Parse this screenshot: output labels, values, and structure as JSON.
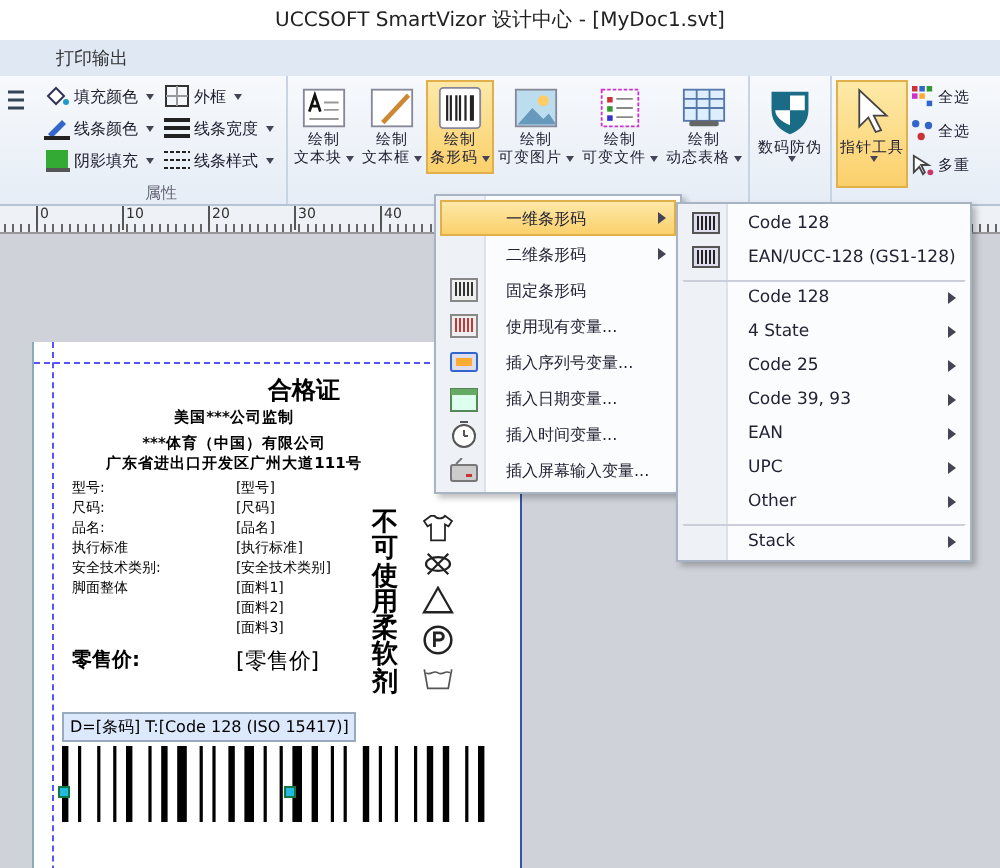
{
  "window": {
    "title": "UCCSOFT SmartVizor 设计中心 - [MyDoc1.svt]"
  },
  "tabs": [
    {
      "label": "打印输出",
      "selected": false
    }
  ],
  "ribbon": {
    "format_group": {
      "label": "属性",
      "tools": [
        {
          "label": "填充颜色"
        },
        {
          "label": "外框"
        },
        {
          "label": "线条颜色"
        },
        {
          "label": "线条宽度"
        },
        {
          "label": "阴影填充"
        },
        {
          "label": "线条样式"
        }
      ]
    },
    "draw_buttons": [
      {
        "line1": "绘制",
        "line2": "文本块",
        "selected": false
      },
      {
        "line1": "绘制",
        "line2": "文本框",
        "selected": false
      },
      {
        "line1": "绘制",
        "line2": "条形码",
        "selected": true
      },
      {
        "line1": "绘制",
        "line2": "可变图片",
        "selected": false
      },
      {
        "line1": "绘制",
        "line2": "可变文件",
        "selected": false
      },
      {
        "line1": "绘制",
        "line2": "动态表格",
        "selected": false
      }
    ],
    "security_button": {
      "label": "数码防伪"
    },
    "pointer_button": {
      "label": "指针工具",
      "selected": true
    },
    "select_tools": [
      {
        "label": "全选"
      },
      {
        "label": "全选"
      },
      {
        "label": "多重"
      }
    ]
  },
  "ruler": {
    "ticks": [
      "0",
      "10",
      "20",
      "30",
      "40"
    ]
  },
  "label": {
    "title": "合格证",
    "lines": [
      "美国***公司监制",
      "***体育（中国）有限公司",
      "广东省进出口开发区广州大道111号"
    ],
    "fields": [
      {
        "name": "型号:",
        "value": "[型号]"
      },
      {
        "name": "尺码:",
        "value": "[尺码]"
      },
      {
        "name": "品名:",
        "value": "[品名]"
      },
      {
        "name": "执行标准",
        "value": "[执行标准]"
      },
      {
        "name": "安全技术类别:",
        "value": "[安全技术类别]"
      },
      {
        "name": "脚面整体",
        "value": "[面料1]"
      },
      {
        "value": "[面料2]"
      },
      {
        "value": "[面料3]"
      }
    ],
    "price": {
      "name": "零售价:",
      "value": "[零售价]"
    },
    "vertical_text": "不可使用柔软剂",
    "barcode_caption": "D=[条码] T:[Code 128 (ISO 15417)]"
  },
  "menu": {
    "items": [
      {
        "label": "一维条形码",
        "submenu": true,
        "selected": true
      },
      {
        "label": "二维条形码",
        "submenu": true,
        "selected": false
      },
      {
        "label": "固定条形码",
        "submenu": false,
        "selected": false
      },
      {
        "label": "使用现有变量...",
        "submenu": false,
        "selected": false
      },
      {
        "label": "插入序列号变量...",
        "submenu": false,
        "selected": false
      },
      {
        "label": "插入日期变量...",
        "submenu": false,
        "selected": false
      },
      {
        "label": "插入时间变量...",
        "submenu": false,
        "selected": false
      },
      {
        "label": "插入屏幕输入变量...",
        "submenu": false,
        "selected": false
      }
    ]
  },
  "submenu": {
    "items": [
      {
        "label": "Code 128",
        "kind": "template",
        "separator_before": false
      },
      {
        "label": "EAN/UCC-128 (GS1-128)",
        "kind": "template",
        "separator_before": false
      },
      {
        "label": "Code 128",
        "kind": "category",
        "separator_before": true
      },
      {
        "label": "4 State",
        "kind": "category",
        "separator_before": false
      },
      {
        "label": "Code 25",
        "kind": "category",
        "separator_before": false
      },
      {
        "label": "Code 39, 93",
        "kind": "category",
        "separator_before": false
      },
      {
        "label": "EAN",
        "kind": "category",
        "separator_before": false
      },
      {
        "label": "UPC",
        "kind": "category",
        "separator_before": false
      },
      {
        "label": "Other",
        "kind": "category",
        "separator_before": false
      },
      {
        "label": "Stack",
        "kind": "category",
        "separator_before": true
      }
    ]
  }
}
